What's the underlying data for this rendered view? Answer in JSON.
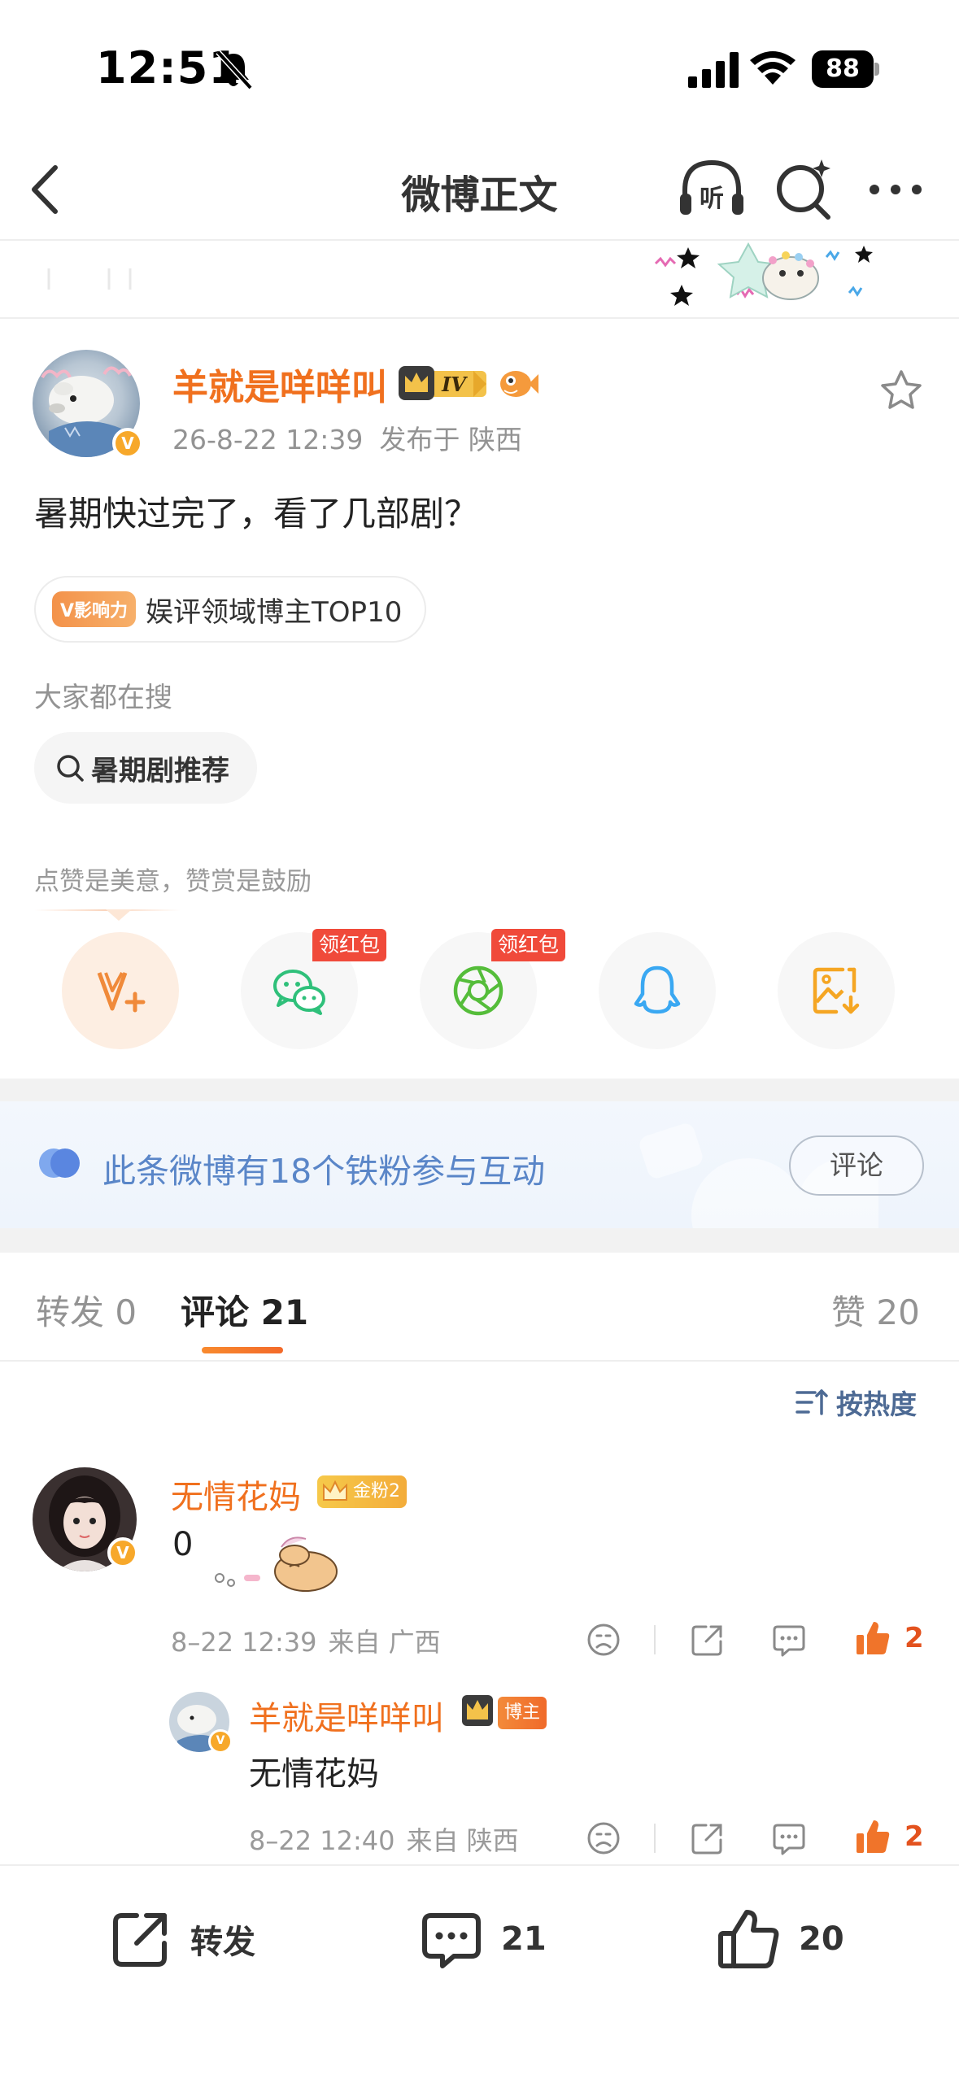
{
  "status_bar": {
    "time": "12:51",
    "battery": "88"
  },
  "nav": {
    "title": "微博正文",
    "listen_label": "听"
  },
  "post": {
    "username": "羊就是咩咩叫",
    "level_badge": "IV",
    "date": "26-8-22 12:39",
    "location": "发布于 陕西",
    "text": "暑期快过完了，看了几部剧？",
    "influence_tag": "V影响力",
    "influence_text": "娱评领域博主TOP10",
    "search_title": "大家都在搜",
    "search_chip": "暑期剧推荐",
    "reward_hint": "点赞是美意，赞赏是鼓励"
  },
  "share": {
    "red_packet_label": "领红包"
  },
  "fans_banner": {
    "text": "此条微博有18个铁粉参与互动",
    "button": "评论"
  },
  "tabs": [
    {
      "label": "转发",
      "count": "0"
    },
    {
      "label": "评论",
      "count": "21"
    },
    {
      "label": "赞",
      "count": "20"
    }
  ],
  "sort_label": "按热度",
  "comments": [
    {
      "username": "无情花妈",
      "badge": "金粉2",
      "text": "0",
      "date": "8–22 12:39",
      "location": "来自 广西",
      "likes": "2"
    },
    {
      "username": "羊就是咩咩叫",
      "badge": "博主",
      "text": "无情花妈",
      "date": "8–22 12:40",
      "location": "来自 陕西",
      "likes": "2"
    }
  ],
  "bottom_bar": {
    "repost": "转发",
    "comments": "21",
    "likes": "20"
  },
  "colors": {
    "accent": "#f0701e",
    "link_blue": "#5a86c8",
    "like": "#e3521e"
  }
}
